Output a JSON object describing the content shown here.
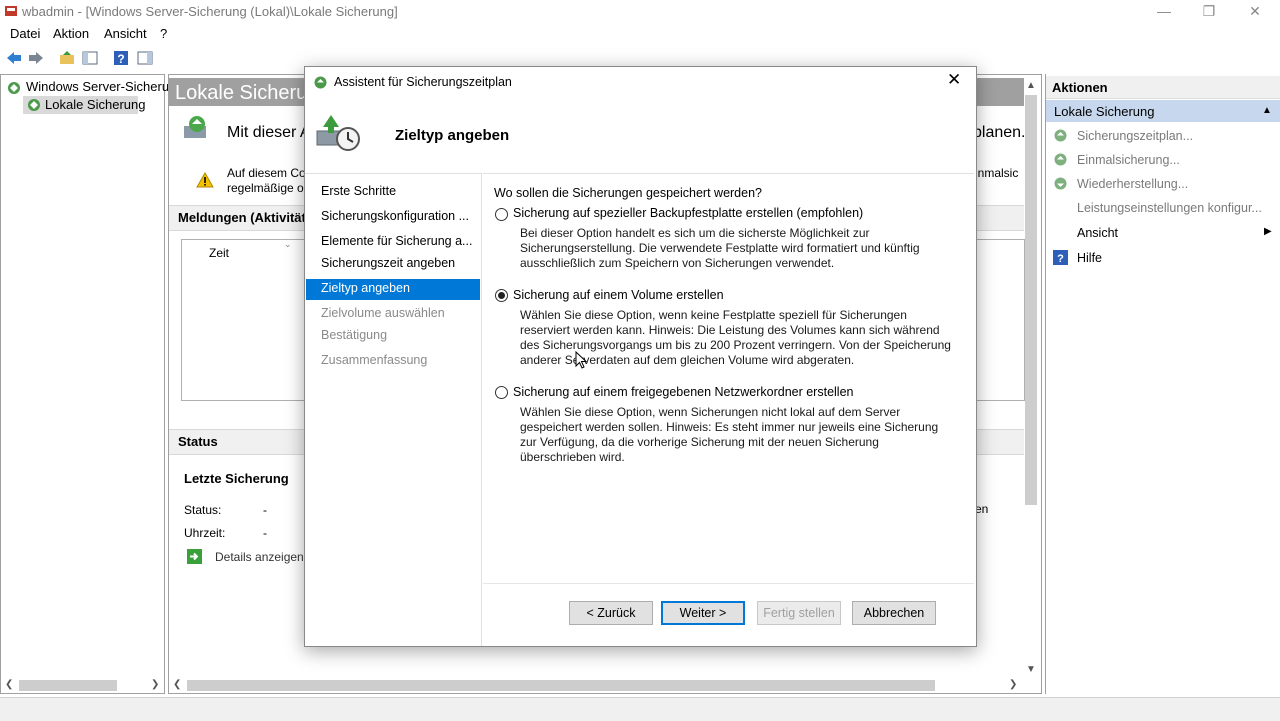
{
  "window": {
    "title": "wbadmin - [Windows Server-Sicherung (Lokal)\\Lokale Sicherung]",
    "minimize_icon": "minimize-icon",
    "restore_icon": "restore-icon",
    "close_icon": "close-icon"
  },
  "menu": {
    "items": [
      "Datei",
      "Aktion",
      "Ansicht",
      "?"
    ]
  },
  "toolbar": {
    "icons": [
      "back-arrow-icon",
      "forward-arrow-icon",
      "folder-up-icon",
      "show-hide-tree-icon",
      "help-icon",
      "show-hide-action-pane-icon"
    ]
  },
  "tree": {
    "root": "Windows Server-Sicherun",
    "child": "Lokale Sicherung"
  },
  "center": {
    "header": "Lokale Sicherun",
    "intro": "Mit dieser A",
    "intro_right": "planen.",
    "warning_line1": "Auf diesem Co",
    "warning_line2": "regelmäßige o",
    "warning_right": "inmalsic",
    "messages_title": "Meldungen (Aktivität f",
    "messages_col_time": "Zeit",
    "status_title": "Status",
    "last_backup_title": "Letzte Sicherung",
    "status_label": "Status:",
    "status_value": "-",
    "time_label": "Uhrzeit:",
    "time_value": "-",
    "details_link": "Details anzeigen",
    "right_fragment": "en"
  },
  "actions": {
    "title": "Aktionen",
    "group": "Lokale Sicherung",
    "items": [
      {
        "label": "Sicherungszeitplan...",
        "icon": "backup-schedule-icon"
      },
      {
        "label": "Einmalsicherung...",
        "icon": "backup-once-icon"
      },
      {
        "label": "Wiederherstellung...",
        "icon": "recover-icon"
      },
      {
        "label": "Leistungseinstellungen konfigur...",
        "icon": ""
      },
      {
        "label": "Ansicht",
        "icon": ""
      },
      {
        "label": "Hilfe",
        "icon": "help-icon"
      }
    ]
  },
  "dialog": {
    "title": "Assistent für Sicherungszeitplan",
    "heading": "Zieltyp angeben",
    "nav": [
      {
        "label": "Erste Schritte",
        "state": "normal"
      },
      {
        "label": "Sicherungskonfiguration ...",
        "state": "normal"
      },
      {
        "label": "Elemente für Sicherung a...",
        "state": "normal"
      },
      {
        "label": "Sicherungszeit angeben",
        "state": "normal"
      },
      {
        "label": "Zieltyp angeben",
        "state": "selected"
      },
      {
        "label": "Zielvolume auswählen",
        "state": "disabled"
      },
      {
        "label": "Bestätigung",
        "state": "disabled"
      },
      {
        "label": "Zusammenfassung",
        "state": "disabled"
      }
    ],
    "question": "Wo sollen die Sicherungen gespeichert werden?",
    "options": [
      {
        "label": "Sicherung auf spezieller Backupfestplatte erstellen (empfohlen)",
        "checked": false,
        "description": "Bei dieser Option handelt es sich um die sicherste Möglichkeit zur Sicherungserstellung. Die verwendete Festplatte wird formatiert und künftig ausschließlich zum Speichern von Sicherungen verwendet."
      },
      {
        "label": "Sicherung auf einem Volume erstellen",
        "checked": true,
        "description": "Wählen Sie diese Option, wenn keine Festplatte speziell für Sicherungen reserviert werden kann. Hinweis: Die Leistung des Volumes kann sich während des Sicherungsvorgangs um bis zu 200 Prozent verringern. Von der Speicherung anderer Serverdaten auf dem gleichen Volume wird abgeraten."
      },
      {
        "label": "Sicherung auf einem freigegebenen Netzwerkordner erstellen",
        "checked": false,
        "description": "Wählen Sie diese Option, wenn Sicherungen nicht lokal auf dem Server gespeichert werden sollen. Hinweis: Es steht immer nur jeweils eine Sicherung zur Verfügung, da die vorherige Sicherung mit der neuen Sicherung überschrieben wird."
      }
    ],
    "buttons": {
      "back": "< Zurück",
      "next": "Weiter >",
      "finish": "Fertig stellen",
      "cancel": "Abbrechen"
    }
  },
  "colors": {
    "accent": "#0078d7",
    "action_group_bg": "#c7d8ee",
    "header_bg": "#a0a0a0"
  }
}
